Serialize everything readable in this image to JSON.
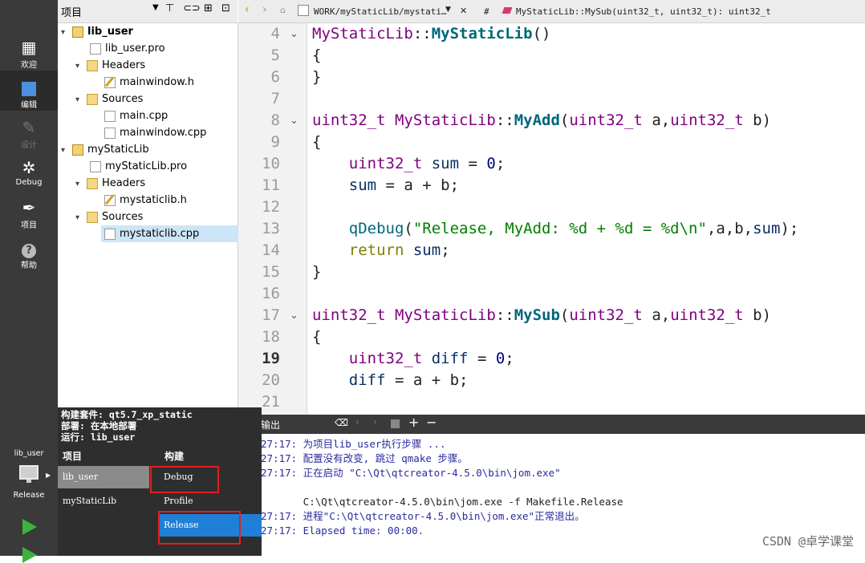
{
  "modes": [
    {
      "label": "欢迎",
      "icon": "grid-icon"
    },
    {
      "label": "编辑",
      "icon": "document-icon"
    },
    {
      "label": "设计",
      "icon": "pencil-icon"
    },
    {
      "label": "Debug",
      "icon": "bug-icon"
    },
    {
      "label": "项目",
      "icon": "wrench-icon"
    },
    {
      "label": "帮助",
      "icon": "question-icon"
    }
  ],
  "project_panel": {
    "title": "项目",
    "tree": [
      {
        "label": "lib_user",
        "bold": true
      },
      {
        "label": "lib_user.pro"
      },
      {
        "label": "Headers"
      },
      {
        "label": "mainwindow.h"
      },
      {
        "label": "Sources"
      },
      {
        "label": "main.cpp"
      },
      {
        "label": "mainwindow.cpp"
      },
      {
        "label": "myStaticLib"
      },
      {
        "label": "myStaticLib.pro"
      },
      {
        "label": "Headers"
      },
      {
        "label": "mystaticlib.h"
      },
      {
        "label": "Sources"
      },
      {
        "label": "mystaticlib.cpp"
      }
    ]
  },
  "editor": {
    "file_path": "WORK/myStaticLib/mystati…",
    "hash": "#",
    "symbol": "MyStaticLib::MySub(uint32_t, uint32_t): uint32_t",
    "current_line": "19",
    "line_numbers": [
      "4",
      "5",
      "6",
      "7",
      "8",
      "9",
      "10",
      "11",
      "12",
      "13",
      "14",
      "15",
      "16",
      "17",
      "18",
      "19",
      "20",
      "21"
    ],
    "tokens": [
      [
        "MyStaticLib",
        "::",
        "MyStaticLib",
        "()"
      ],
      [
        "{"
      ],
      [
        "}"
      ],
      [],
      [
        "uint32_t",
        " ",
        "MyStaticLib",
        "::",
        "MyAdd",
        "(",
        "uint32_t",
        " a,",
        "uint32_t",
        " b)"
      ],
      [
        "{"
      ],
      [
        "    ",
        "uint32_t",
        " ",
        "sum",
        " = ",
        "0",
        ";"
      ],
      [
        "    ",
        "sum",
        " = a + b;"
      ],
      [],
      [
        "    ",
        "qDebug",
        "(",
        "\"Release, MyAdd: %d + %d = %d\\n\"",
        ",a,b,",
        "sum",
        ");"
      ],
      [
        "    ",
        "return",
        " ",
        "sum",
        ";"
      ],
      [
        "}"
      ],
      [],
      [
        "uint32_t",
        " ",
        "MyStaticLib",
        "::",
        "MySub",
        "(",
        "uint32_t",
        " a,",
        "uint32_t",
        " b)"
      ],
      [
        "{"
      ],
      [
        "    ",
        "uint32_t",
        " ",
        "diff",
        " = ",
        "0",
        ";"
      ],
      [
        "    ",
        "diff",
        " = a + b;"
      ],
      []
    ]
  },
  "output": {
    "title": "输出",
    "lines": [
      "27:17: 为项目lib_user执行步骤 ...",
      "27:17: 配置没有改变, 跳过 qmake 步骤。",
      "27:17: 正在启动 \"C:\\Qt\\qtcreator-4.5.0\\bin\\jom.exe\"",
      "",
      "       C:\\Qt\\qtcreator-4.5.0\\bin\\jom.exe -f Makefile.Release",
      "27:17: 进程\"C:\\Qt\\qtcreator-4.5.0\\bin\\jom.exe\"正常退出。",
      "27:17: Elapsed time: 00:00."
    ]
  },
  "kit_popup": {
    "kit_line": "构建套件: qt5.7_xp_static",
    "deploy_line": "部署: 在本地部署",
    "run_line": "运行: lib_user",
    "project_header": "项目",
    "build_header": "构建",
    "projects": [
      "lib_user",
      "myStaticLib"
    ],
    "builds": [
      "Debug",
      "Profile",
      "Release"
    ]
  },
  "target_selector": {
    "project": "lib_user",
    "config": "Release"
  },
  "watermark": "CSDN @卓学课堂",
  "colors": {
    "sidebar_bg": "#3a3a3a",
    "selection_blue": "#1f7fd6",
    "highlight_red": "#e0201e",
    "run_green": "#3db33d"
  }
}
